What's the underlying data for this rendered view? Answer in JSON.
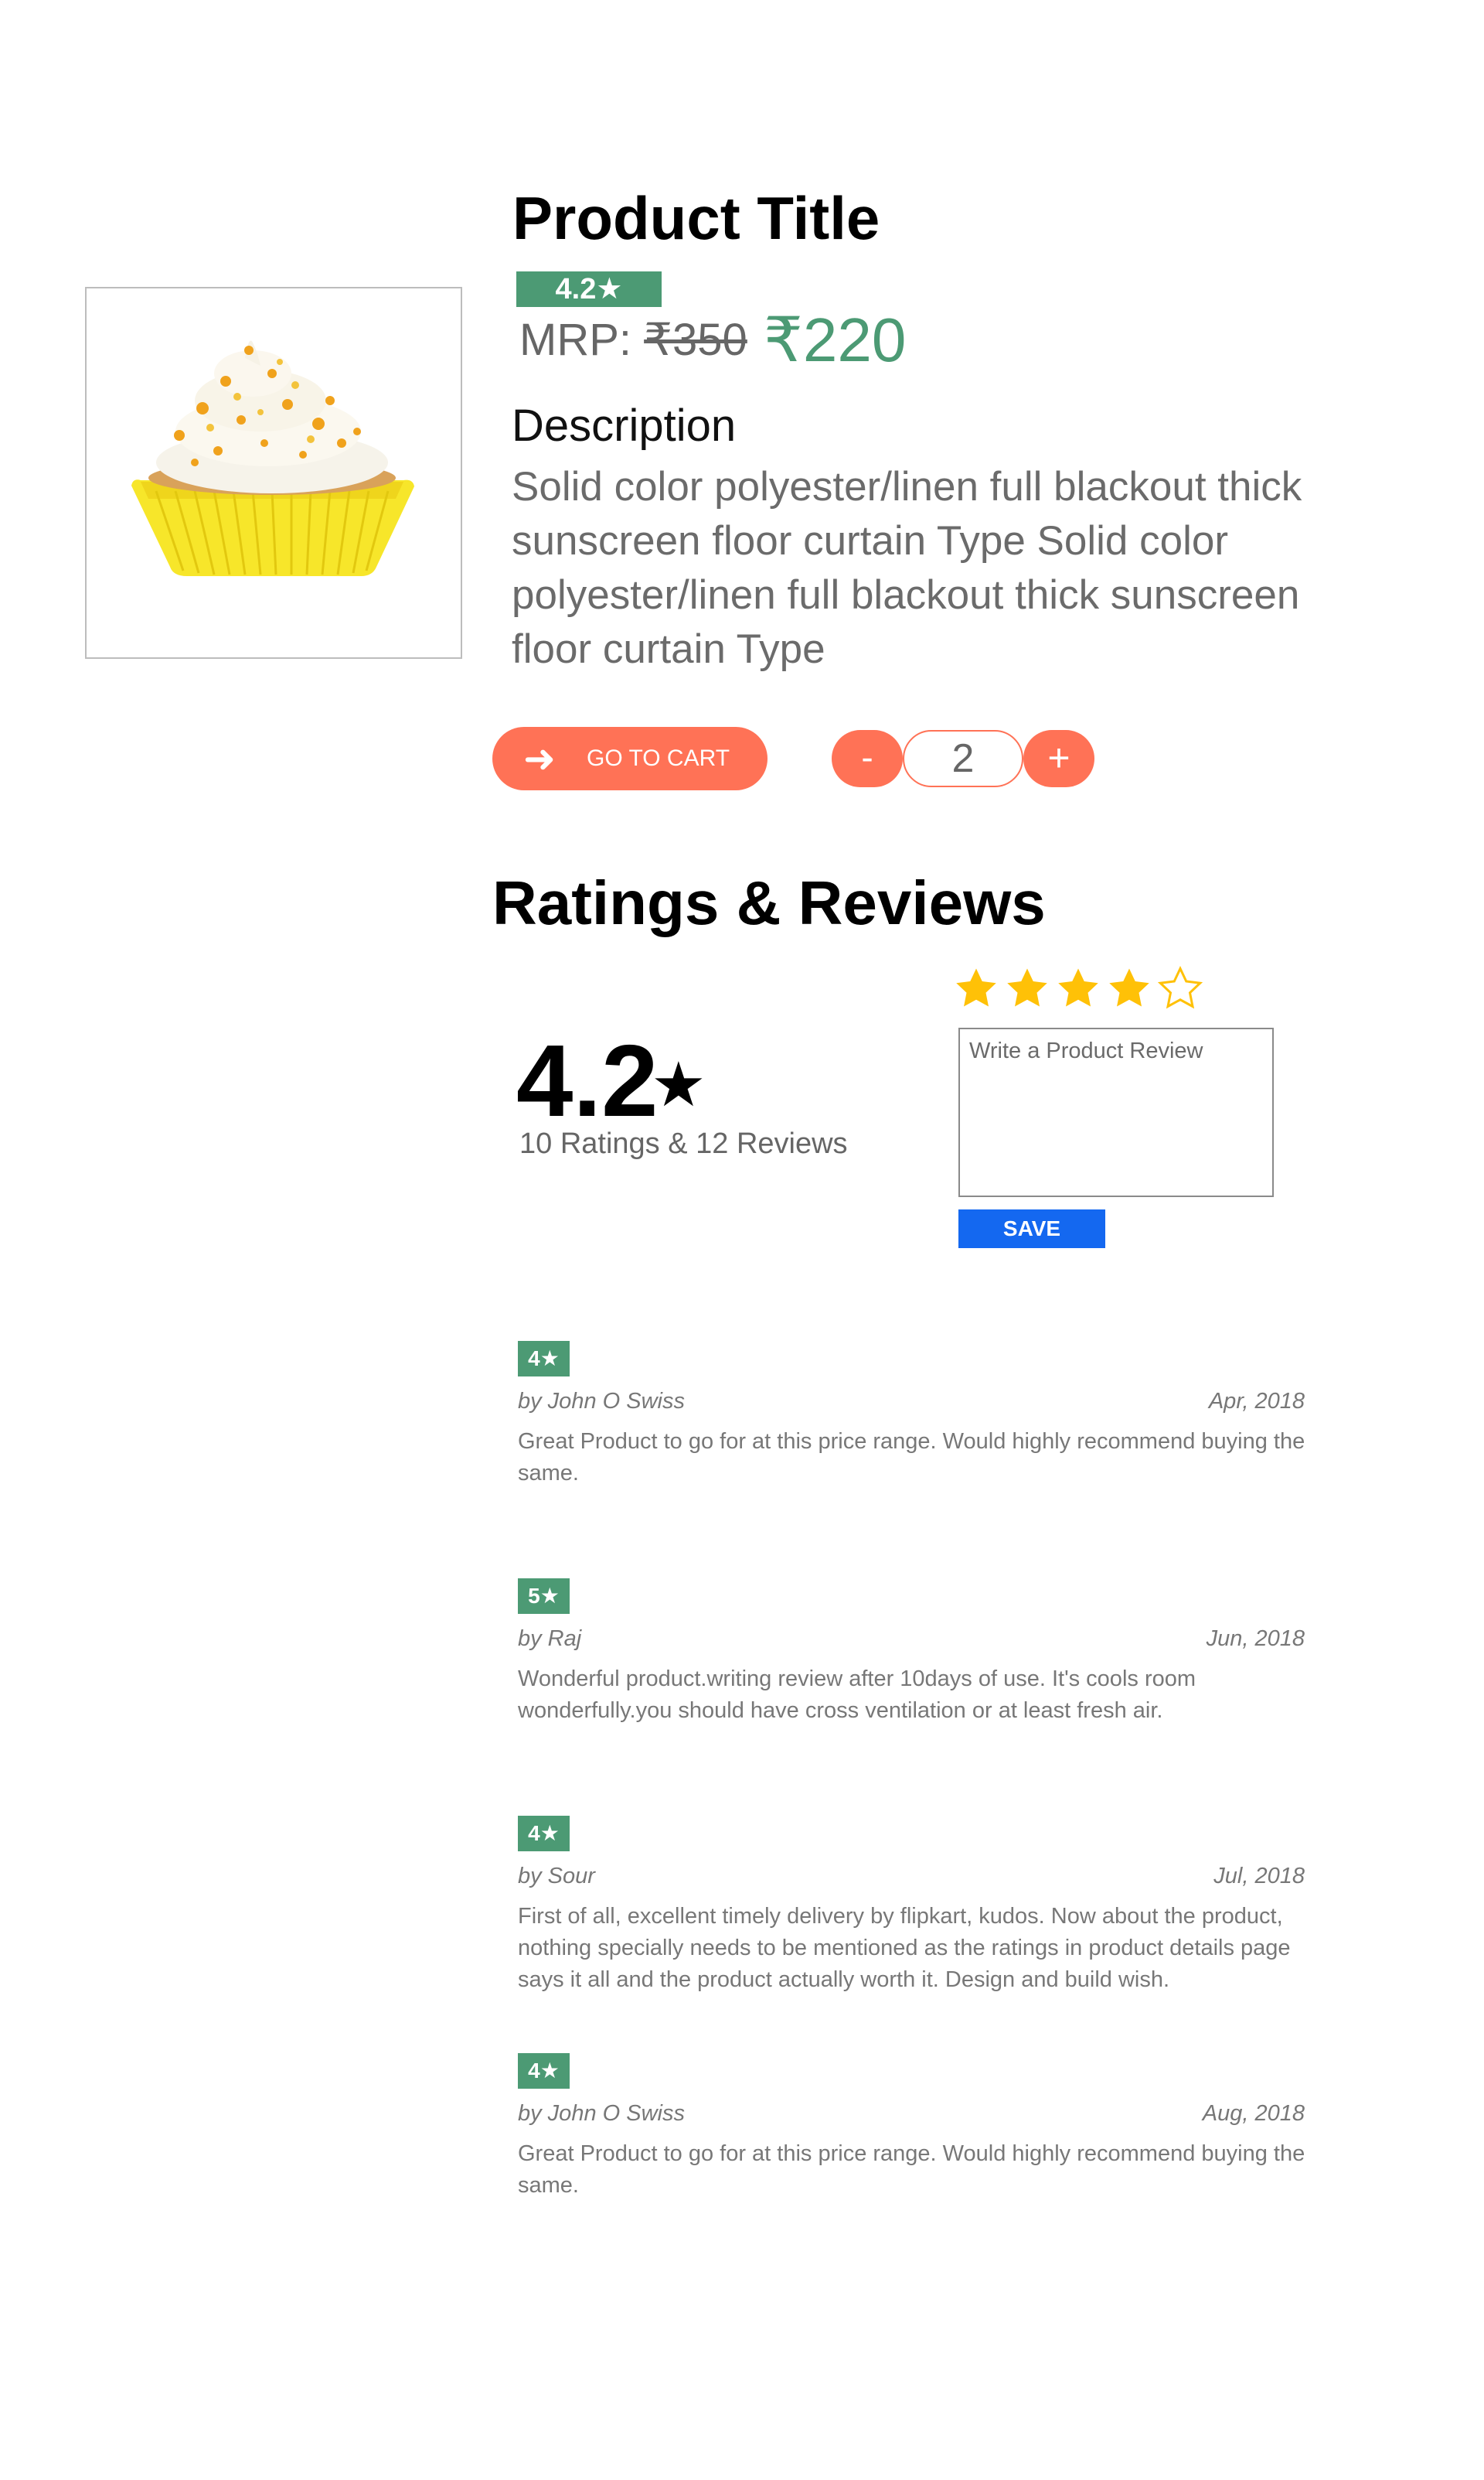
{
  "product": {
    "title": "Product Title",
    "rating_badge": "4.2★",
    "mrp_label": "MRP: ",
    "mrp_value": "₹350",
    "price": "₹220",
    "description_heading": "Description",
    "description_text": "Solid color polyester/linen full blackout thick sunscreen floor curtain Type Solid color polyester/linen full blackout thick sunscreen floor curtain Type",
    "image_icon": "cupcake-image"
  },
  "actions": {
    "go_to_cart_icon": "arrow-right-icon",
    "go_to_cart_label": "GO TO CART",
    "minus_label": "-",
    "plus_label": "+",
    "quantity": "2"
  },
  "ratings": {
    "heading": "Ratings & Reviews",
    "average": "4.2",
    "star_glyph": "★",
    "summary": "10 Ratings & 12 Reviews",
    "selected_stars": 4,
    "max_stars": 5,
    "review_placeholder": "Write a Product Review",
    "save_label": "SAVE"
  },
  "reviews": [
    {
      "badge": "4★",
      "author": "by John O Swiss",
      "date": "Apr, 2018",
      "text": "Great Product to go for at this price range. Would highly recommend buying the same."
    },
    {
      "badge": "5★",
      "author": "by Raj",
      "date": "Jun, 2018",
      "text": "Wonderful product.writing review after 10days of use. It's cools room wonderfully.you should have cross ventilation or at least fresh air."
    },
    {
      "badge": "4★",
      "author": "by Sour",
      "date": "Jul, 2018",
      "text": "First of all, excellent timely delivery by flipkart, kudos. Now about the product, nothing specially needs to be mentioned as the ratings in product details page says it all and the product actually worth it. Design and build wish."
    },
    {
      "badge": "4★",
      "author": "by John O Swiss",
      "date": "Aug, 2018",
      "text": "Great Product to go for at this price range. Would highly recommend buying the same."
    }
  ],
  "colors": {
    "accent_green": "#4c9a74",
    "button_orange": "#ff7256",
    "save_blue": "#1468f0",
    "star_gold": "#ffc107"
  }
}
